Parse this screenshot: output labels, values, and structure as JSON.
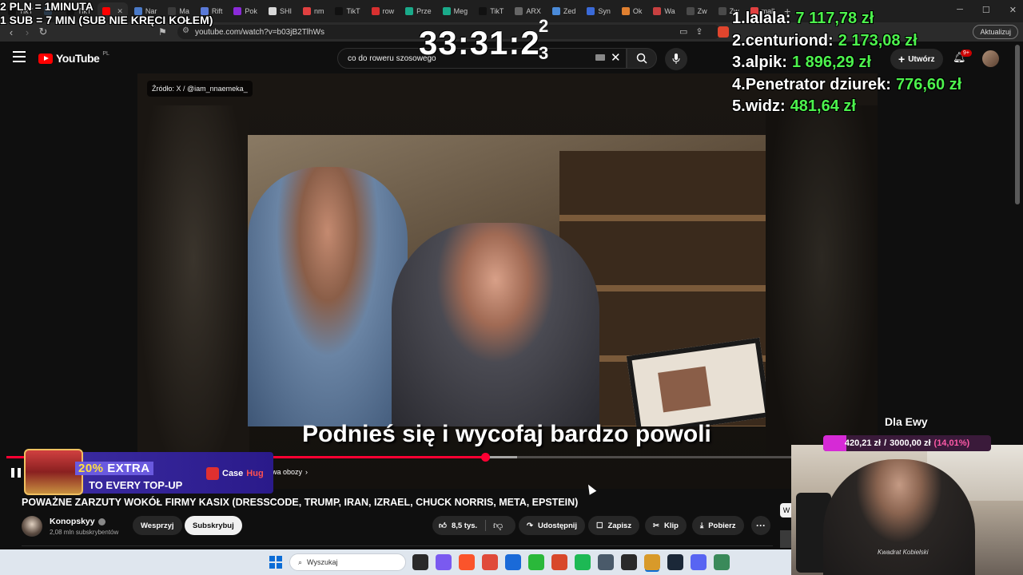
{
  "browser": {
    "tabs": [
      {
        "label": "TikT",
        "color": "#111111"
      },
      {
        "label": "",
        "color": "#2a3a4a"
      },
      {
        "label": "TikT",
        "color": "#111111"
      },
      {
        "label": "",
        "color": "#ff0000",
        "active": true
      },
      {
        "label": "Nar",
        "color": "#4a7ac8"
      },
      {
        "label": "Ma",
        "color": "#3a3a3a"
      },
      {
        "label": "Rift",
        "color": "#5a7ad8"
      },
      {
        "label": "Pok",
        "color": "#8a2ad8"
      },
      {
        "label": "SHI",
        "color": "#d8d8d8"
      },
      {
        "label": "nm",
        "color": "#e04040"
      },
      {
        "label": "TikT",
        "color": "#111111"
      },
      {
        "label": "row",
        "color": "#d83030"
      },
      {
        "label": "Prze",
        "color": "#1aaa8a"
      },
      {
        "label": "Meg",
        "color": "#1aaa8a"
      },
      {
        "label": "TikT",
        "color": "#111111"
      },
      {
        "label": "ARX",
        "color": "#666666"
      },
      {
        "label": "Zed",
        "color": "#4a8ad8"
      },
      {
        "label": "Syn",
        "color": "#3a6ad8"
      },
      {
        "label": "Ok",
        "color": "#e08030"
      },
      {
        "label": "Wa",
        "color": "#c84040"
      },
      {
        "label": "Zw",
        "color": "#4a4a4a"
      },
      {
        "label": "Zw",
        "color": "#4a4a4a"
      },
      {
        "label": "mall",
        "color": "#e04040"
      }
    ],
    "url": "youtube.com/watch?v=b03jB2TlhWs",
    "update_label": "Aktualizuj"
  },
  "youtube": {
    "logo_text": "YouTube",
    "country": "PL",
    "search_value": "co do roweru szosowego",
    "create_label": "Utwórz",
    "notif_count": "9+",
    "source_tag": "Źródło: X / @iam_nnaemeka_",
    "subtitle": "Podnieś się i wycofaj bardzo powoli",
    "chapter_label": "wa obozy",
    "progress_played": 0.593,
    "progress_loaded": 0.633,
    "video_title": "POWAŻNE ZARZUTY WOKÓŁ FIRMY KASIX (DRESSCODE, TRUMP, IRAN, IZRAEL, CHUCK NORRIS, META, EPSTEIN)",
    "channel_name": "Konopskyy",
    "channel_subs": "2,08 mln subskrybentów",
    "support_label": "Wesprzyj",
    "subscribe_label": "Subskrybuj",
    "like_count": "8,5 tys.",
    "share_label": "Udostępnij",
    "save_label": "Zapisz",
    "clip_label": "Klip",
    "download_label": "Pobierz",
    "side_label": "W"
  },
  "overlay": {
    "rate_line1": "2 PLN = 1MINUTA",
    "rate_line2": "1 SUB = 7 MIN (SUB NIE KRĘCI KOŁEM)",
    "timer": "33:31:2",
    "timer_sup": "2",
    "timer_sub": "3",
    "leaderboard": [
      {
        "rank": "1.",
        "name": "lalala:",
        "amount": "7 117,78 zł"
      },
      {
        "rank": "2.",
        "name": "centuriond:",
        "amount": "2 173,08 zł"
      },
      {
        "rank": "3.",
        "name": "alpik:",
        "amount": "1 896,29 zł"
      },
      {
        "rank": "4.",
        "name": "Penetrator dziurek:",
        "amount": "776,60 zł"
      },
      {
        "rank": "5.",
        "name": "widz:",
        "amount": "481,64 zł"
      }
    ],
    "goal_title": "Dla Ewy",
    "goal_current": "420,21 zł",
    "goal_target": "3000,00 zł",
    "goal_percent": "(14,01%)",
    "goal_fraction": 0.1401,
    "webcam_shirt": "Kwadrat Kobielski"
  },
  "ad": {
    "line1_highlight": "20%",
    "line1_rest": "EXTRA",
    "line2": "TO EVERY TOP-UP",
    "brand_a": "Case",
    "brand_b": "Hug"
  },
  "taskbar": {
    "search_placeholder": "Wyszukaj",
    "icons": [
      {
        "name": "task-view-icon",
        "color": "#2a2a2a"
      },
      {
        "name": "copilot-icon",
        "color": "#7a5af0"
      },
      {
        "name": "brave-icon",
        "color": "#fb542b"
      },
      {
        "name": "chrome-icon",
        "color": "#e04a3a"
      },
      {
        "name": "store-icon",
        "color": "#1a6ad8"
      },
      {
        "name": "game-icon",
        "color": "#2ab83a"
      },
      {
        "name": "brave-alt-icon",
        "color": "#d8482b"
      },
      {
        "name": "spotify-icon",
        "color": "#1db954"
      },
      {
        "name": "calculator-icon",
        "color": "#4a5a6a"
      },
      {
        "name": "obs-icon",
        "color": "#2a2a2a"
      },
      {
        "name": "app-icon",
        "color": "#d89a2a"
      },
      {
        "name": "steam-icon",
        "color": "#1b2838"
      },
      {
        "name": "discord-icon",
        "color": "#5865f2"
      },
      {
        "name": "app2-icon",
        "color": "#3a8a5a"
      }
    ]
  }
}
